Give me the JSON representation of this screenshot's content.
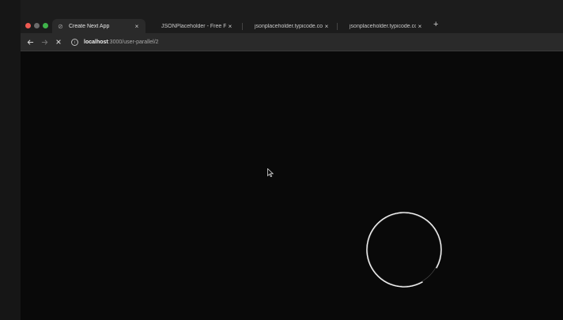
{
  "browser": {
    "tabs": [
      {
        "title": "Create Next App",
        "favicon": "loading-icon",
        "active": true
      },
      {
        "title": "JSONPlaceholder - Free Fake",
        "favicon": "",
        "active": false
      },
      {
        "title": "jsonplaceholder.typicode.co",
        "favicon": "",
        "active": false
      },
      {
        "title": "jsonplaceholder.typicode.co",
        "favicon": "",
        "active": false
      }
    ],
    "tab_close_glyph": "×",
    "new_tab_glyph": "+",
    "address": {
      "host": "localhost",
      "path": ":3000/user-parallel/2"
    }
  },
  "colors": {
    "accent_red": "#ee5a52",
    "accent_green": "#3fb34a",
    "page_background": "#090909",
    "spinner": "#ffffff"
  },
  "icons": [
    "back-arrow-icon",
    "forward-arrow-icon",
    "stop-icon",
    "site-info-icon",
    "loading-spinner-icon",
    "mouse-cursor-icon"
  ]
}
